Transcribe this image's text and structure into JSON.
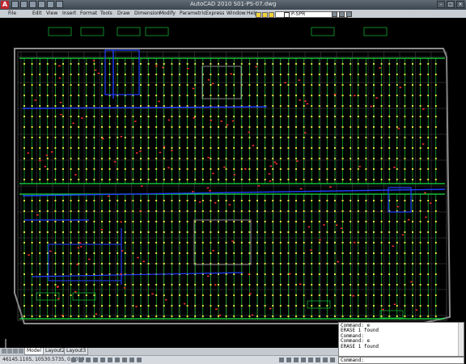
{
  "window": {
    "title": "AutoCAD 2010   S01-PS-07.dwg",
    "logo": "A"
  },
  "menu": [
    "File",
    "Edit",
    "View",
    "Insert",
    "Format",
    "Tools",
    "Draw",
    "Dimension",
    "Modify",
    "Parametric",
    "Express",
    "Window",
    "Help"
  ],
  "layer": {
    "current": "P-SPR"
  },
  "tabs": [
    "Model",
    "Layout2",
    "Layout3"
  ],
  "active_tab": "Model",
  "status": {
    "coordinates": "46145.1105, 10530.5735, 0.0000"
  },
  "command_history": [
    "Command: e",
    "ERASE 1 found",
    "Command:",
    "Command: e",
    "ERASE 1 found"
  ],
  "command_prompt": "Command:",
  "colors": {
    "drawing_bg": "#000000",
    "sprinkler_green": "#18e040",
    "pipe_blue": "#2040ff",
    "wall_gray": "#8c8c8c",
    "yellow": "#f0e040"
  }
}
